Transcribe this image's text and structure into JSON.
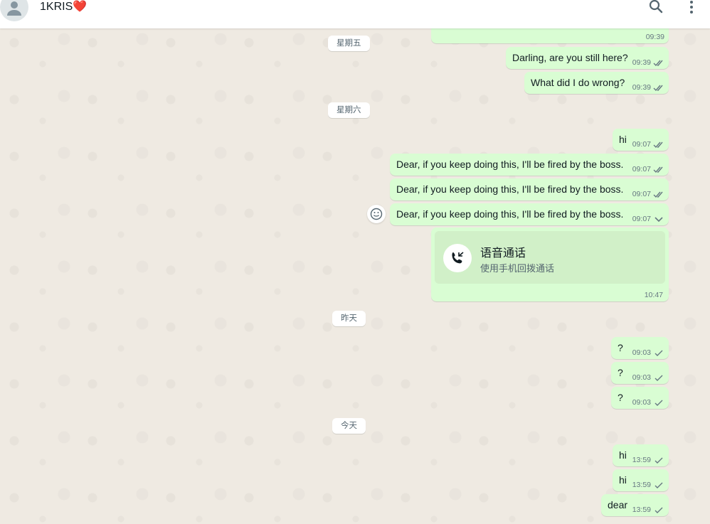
{
  "header": {
    "contact_name": "1KRIS",
    "contact_emoji": "❤️",
    "icons": [
      "person-avatar-icon",
      "search-icon",
      "more-vertical-icon"
    ]
  },
  "colors": {
    "bubble_out": "#d9fdd3",
    "chat_background": "#efeae2",
    "tick_read": "#667781"
  },
  "date_chips": [
    "星期五",
    "星期六",
    "昨天",
    "今天"
  ],
  "messages": [
    {
      "text": "",
      "time": "09:39",
      "ticks": ""
    },
    {
      "text": "Darling, are you still here?",
      "time": "09:39",
      "ticks": "double"
    },
    {
      "text": "What did I do wrong?",
      "time": "09:39",
      "ticks": "double"
    },
    {
      "text": "hi",
      "time": "09:07",
      "ticks": "double"
    },
    {
      "text": "Dear, if you keep doing this, I'll be fired by the boss.",
      "time": "09:07",
      "ticks": "double"
    },
    {
      "text": "Dear, if you keep doing this, I'll be fired by the boss.",
      "time": "09:07",
      "ticks": "double"
    },
    {
      "text": "Dear, if you keep doing this, I'll be fired by the boss.",
      "time": "09:07",
      "ticks": "double"
    },
    {
      "text": "?",
      "time": "09:03",
      "ticks": "single"
    },
    {
      "text": "?",
      "time": "09:03",
      "ticks": "single"
    },
    {
      "text": "?",
      "time": "09:03",
      "ticks": "single"
    },
    {
      "text": "hi",
      "time": "13:59",
      "ticks": "single"
    },
    {
      "text": "hi",
      "time": "13:59",
      "ticks": "single"
    },
    {
      "text": "dear",
      "time": "13:59",
      "ticks": "single"
    }
  ],
  "voice_call": {
    "title": "语音通话",
    "subtitle": "使用手机回拨通话",
    "time": "10:47",
    "icon": "phone-callback-icon"
  }
}
